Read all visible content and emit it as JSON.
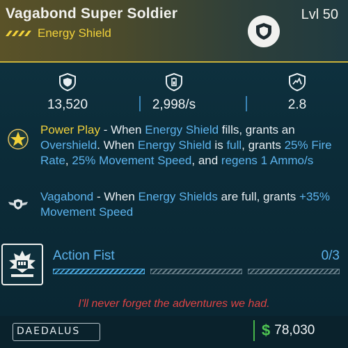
{
  "item": {
    "name": "Vagabond Super Soldier",
    "level": "Lvl 50",
    "subtype": "Energy Shield"
  },
  "stats": [
    {
      "icon": "shield-icon",
      "value": "13,520"
    },
    {
      "icon": "battery-shield-icon",
      "value": "2,998/s"
    },
    {
      "icon": "clock-shield-icon",
      "value": "2.8"
    }
  ],
  "perks": {
    "power_play": {
      "icon": "star-badge-icon",
      "name": "Power Play",
      "t1": " - When ",
      "h1": "Energy Shield",
      "t2": " fills, grants an ",
      "h2": "Overshield",
      "t3": ". When ",
      "h3": "Energy Shield",
      "t4": " is ",
      "h4": "full",
      "t5": ", grants ",
      "h5": "25% Fire Rate",
      "t6": ", ",
      "h6": "25% Movement Speed",
      "t7": ", and ",
      "h7": "regens 1 Ammo/s"
    },
    "vagabond": {
      "icon": "winged-emblem-icon",
      "name": "Vagabond",
      "t1": " - When ",
      "h1": "Energy Shields",
      "t2": " are full, grants ",
      "h2": "+35% Movement Speed"
    }
  },
  "action": {
    "icon": "fist-icon",
    "name": "Action Fist",
    "count": "0/3",
    "segments": 3
  },
  "quote": "I'll never forget the adventures we had.",
  "manufacturer": "DAEDALUS",
  "price": {
    "currency": "$",
    "amount": "78,030"
  },
  "colors": {
    "highlight": "#5db4ee",
    "rarity_gold": "#f2d23a",
    "quote_red": "#e04444",
    "money_green": "#4fc552"
  }
}
